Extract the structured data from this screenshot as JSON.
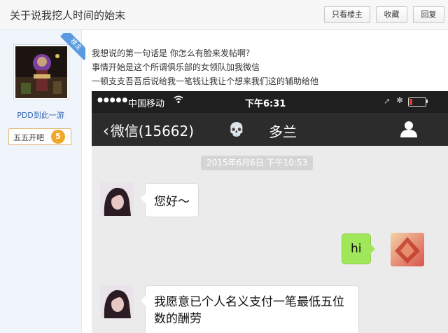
{
  "thread": {
    "title": "关于说我挖人时间的始末",
    "buttons": {
      "only_op": "只看楼主",
      "favorite": "收藏",
      "reply": "回复"
    }
  },
  "user": {
    "name": "PDD到此一游",
    "badge": "楼主",
    "level_name": "五五开吧",
    "level_number": "5"
  },
  "post": {
    "lines": [
      "我想说的第一句话是 你怎么有脸来发帖啊？",
      "事情开始是这个所谓俱乐部的女领队加我微信",
      "一顿支支吾吾后说给我一笔钱让我让个想来我们这的辅助给他"
    ]
  },
  "phone": {
    "status": {
      "signal": "●●●●●",
      "carrier": "中国移动",
      "time": "下午6:31",
      "battery_level": 0.2
    },
    "nav": {
      "back_label": "微信(15662)",
      "title": "多兰",
      "skull_icon": "💀"
    },
    "timestamp": "2015年6月6日 下午10:53",
    "messages": [
      {
        "side": "left",
        "text": "您好～"
      },
      {
        "side": "right",
        "text": "hi"
      },
      {
        "side": "left",
        "text": "我愿意已个人名义支付一笔最低五位数的酬劳"
      }
    ]
  },
  "colors": {
    "accent_blue": "#2d64b3",
    "wechat_green": "#a0e759",
    "level_orange": "#f1a82a"
  }
}
